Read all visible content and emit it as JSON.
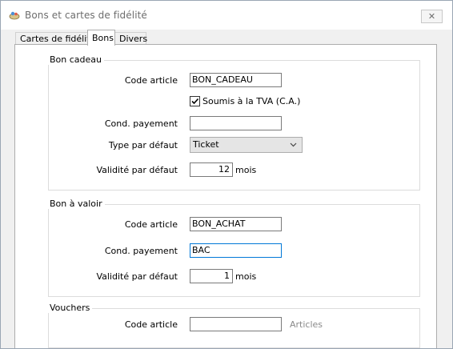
{
  "window": {
    "title": "Bons et cartes de fidélité",
    "close_label": "✕"
  },
  "tabs": [
    {
      "label": "Cartes de fidélité"
    },
    {
      "label": "Bons"
    },
    {
      "label": "Divers"
    }
  ],
  "bon_cadeau": {
    "legend": "Bon cadeau",
    "code_article_label": "Code article",
    "code_article_value": "BON_CADEAU",
    "tva_label": "Soumis à la TVA (C.A.)",
    "tva_checked": true,
    "cond_payement_label": "Cond. payement",
    "cond_payement_value": "",
    "type_label": "Type par défaut",
    "type_value": "Ticket",
    "validite_label": "Validité par défaut",
    "validite_value": "12",
    "validite_unit": "mois"
  },
  "bon_valoir": {
    "legend": "Bon à valoir",
    "code_article_label": "Code article",
    "code_article_value": "BON_ACHAT",
    "cond_payement_label": "Cond. payement",
    "cond_payement_value": "BAC",
    "validite_label": "Validité par défaut",
    "validite_value": "1",
    "validite_unit": "mois"
  },
  "vouchers": {
    "legend": "Vouchers",
    "code_article_label": "Code article",
    "code_article_value": "",
    "articles_label": "Articles"
  },
  "icons": {
    "app": "gift-card-icon",
    "close": "close-icon",
    "check": "checkmark-icon",
    "chevron": "chevron-down-icon"
  }
}
